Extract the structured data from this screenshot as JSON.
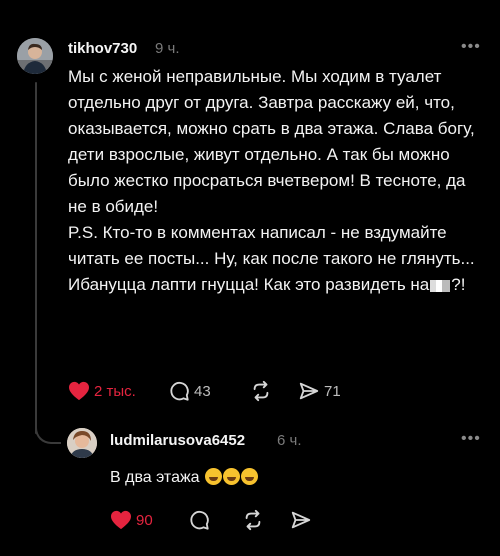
{
  "post": {
    "author": "tikhov730",
    "time": "9 ч.",
    "paragraphs": [
      "Мы с женой неправильные. Мы ходим в туалет отдельно друг от друга. Завтра расскажу ей, что, оказывается, можно срать в два этажа. Слава богу, дети взрослые, живут отдельно. А так бы можно было жестко просраться вчетвером! В тесноте, да не в обиде!",
      "P.S. Кто-то в комментах написал - не вздумайте читать ее посты... Ну, как после такого не глянуть... Ибануцца лапти гнуцца! Как это развидеть на",
      "?!"
    ],
    "likes": "2 тыс.",
    "comments": "43",
    "shares": "71"
  },
  "reply": {
    "author": "ludmilarusova6452",
    "time": "6 ч.",
    "text": "В два этажа",
    "likes": "90"
  },
  "colors": {
    "background": "#000000",
    "like_red": "#e5243f",
    "muted": "#7a7a7a"
  },
  "icons": [
    "heart-icon",
    "comment-icon",
    "repost-icon",
    "share-icon",
    "more-icon"
  ]
}
